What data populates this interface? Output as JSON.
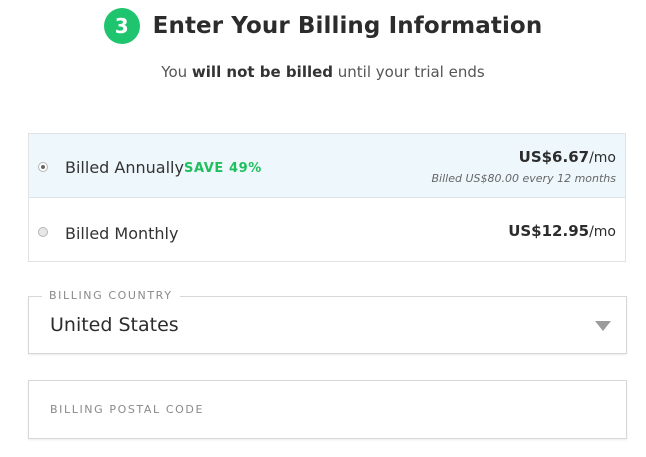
{
  "header": {
    "step_number": "3",
    "title": "Enter Your Billing Information"
  },
  "subtitle": {
    "prefix": "You ",
    "emphasis": "will not be billed",
    "suffix": " until your trial ends"
  },
  "plans": {
    "annual": {
      "label": "Billed Annually",
      "selected": true,
      "badge": "SAVE 49%",
      "price": "US$6.67",
      "per": "/mo",
      "note": "Billed US$80.00 every 12 months"
    },
    "monthly": {
      "label": "Billed Monthly",
      "selected": false,
      "price": "US$12.95",
      "per": "/mo"
    }
  },
  "billing_country": {
    "label": "BILLING COUNTRY",
    "value": "United States"
  },
  "billing_postal": {
    "placeholder": "BILLING POSTAL CODE",
    "value": ""
  },
  "colors": {
    "accent_green": "#1fc46e",
    "selected_background": "#eef7fc"
  },
  "icons": {
    "step": "step-number-badge",
    "dropdown": "chevron-down-icon"
  }
}
